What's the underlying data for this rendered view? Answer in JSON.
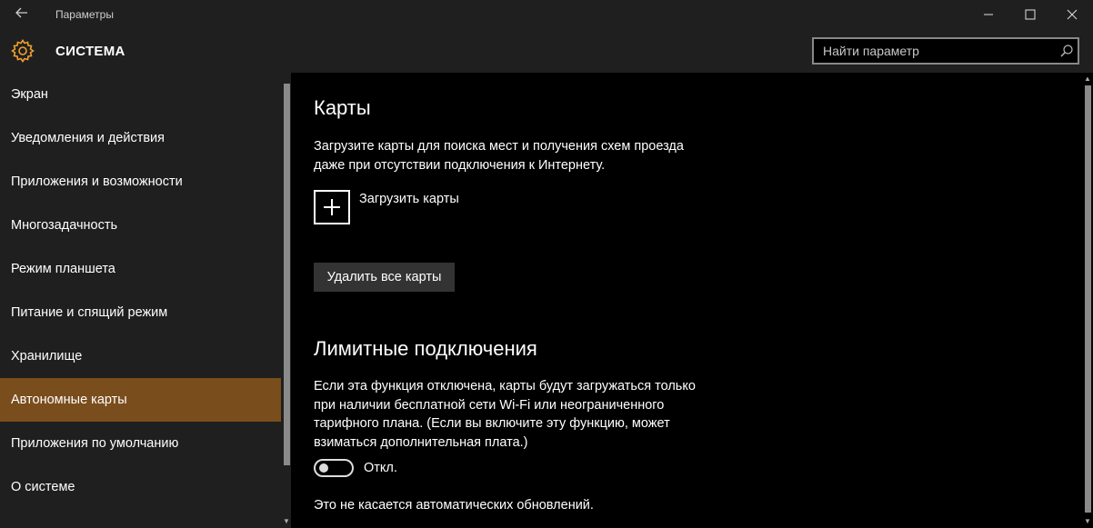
{
  "window": {
    "title": "Параметры",
    "back_icon": "back-arrow-icon",
    "minimize_icon": "minimize-icon",
    "maximize_icon": "maximize-icon",
    "close_icon": "close-icon"
  },
  "header": {
    "icon": "gear-icon",
    "section": "СИСТЕМА",
    "accent": "#f0a030",
    "search_placeholder": "Найти параметр",
    "search_icon": "search-icon"
  },
  "sidebar": {
    "items": [
      {
        "label": "Экран"
      },
      {
        "label": "Уведомления и действия"
      },
      {
        "label": "Приложения и возможности"
      },
      {
        "label": "Многозадачность"
      },
      {
        "label": "Режим планшета"
      },
      {
        "label": "Питание и спящий режим"
      },
      {
        "label": "Хранилище"
      },
      {
        "label": "Автономные карты",
        "selected": true
      },
      {
        "label": "Приложения по умолчанию"
      },
      {
        "label": "О системе"
      }
    ],
    "selected_color": "#7a4d1c"
  },
  "content": {
    "maps_title": "Карты",
    "maps_desc_line1": "Загрузите карты для поиска мест и получения схем проезда",
    "maps_desc_line2": "даже при отсутствии подключения к Интернету.",
    "download_icon": "plus-icon",
    "download_label": "Загрузить карты",
    "delete_button": "Удалить все карты",
    "metered_title": "Лимитные подключения",
    "metered_desc_line1": "Если эта функция отключена, карты будут загружаться только",
    "metered_desc_line2": "при наличии бесплатной сети Wi-Fi или неограниченного",
    "metered_desc_line3": "тарифного плана. (Если вы включите эту функцию, может",
    "metered_desc_line4": "взиматься дополнительная плата.)",
    "toggle_state": "off",
    "toggle_label": "Откл.",
    "updates_note": "Это не касается автоматических обновлений."
  }
}
